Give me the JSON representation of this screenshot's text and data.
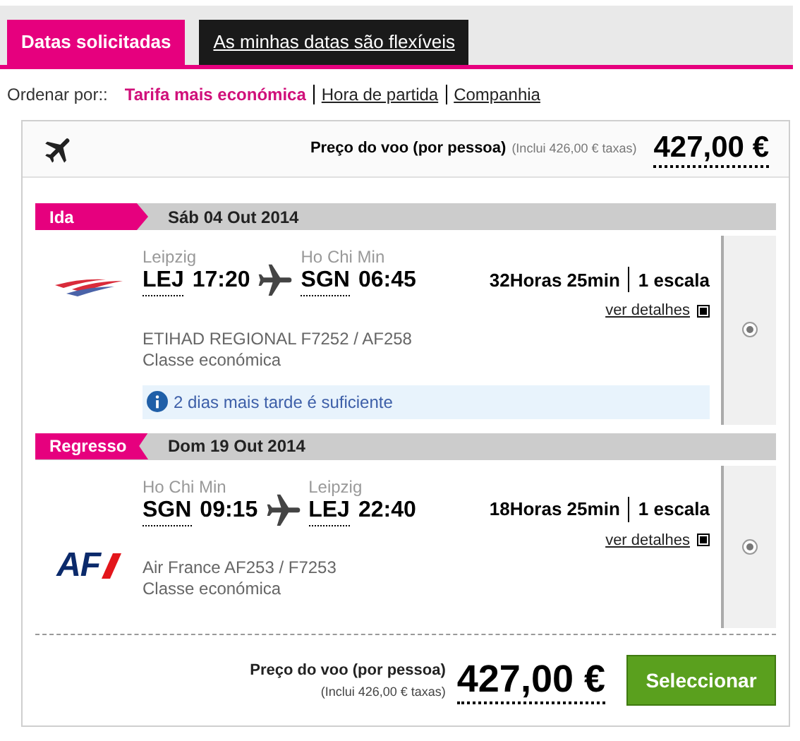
{
  "tabs": [
    {
      "label": "Datas solicitadas",
      "selected": true
    },
    {
      "label": "As minhas datas são flexíveis",
      "selected": false
    }
  ],
  "sort": {
    "label": "Ordenar por::",
    "options": [
      {
        "label": "Tarifa mais económica",
        "selected": true
      },
      {
        "label": "Hora de partida",
        "selected": false
      },
      {
        "label": "Companhia",
        "selected": false
      }
    ]
  },
  "header": {
    "price_label": "Preço do voo (por pessoa)",
    "taxes": "(Inclui 426,00 € taxas)",
    "price": "427,00 €"
  },
  "legs": [
    {
      "kind": "outbound",
      "tag": "Ida",
      "date": "Sáb 04 Out 2014",
      "logo": {
        "kind": "swoosh"
      },
      "from_city": "Leipzig",
      "from_code": "LEJ",
      "from_time": "17:20",
      "to_city": "Ho Chi Min",
      "to_code": "SGN",
      "to_time": "06:45",
      "duration": "32Horas 25min",
      "stops": "1 escala",
      "details": "ver detalhes",
      "flight": "ETIHAD REGIONAL F7252 / AF258",
      "cabin": "Classe económica",
      "note": "2 dias mais tarde é suficiente",
      "selected": true
    },
    {
      "kind": "return",
      "tag": "Regresso",
      "date": "Dom 19 Out 2014",
      "logo": {
        "kind": "wordmark",
        "text": "AF"
      },
      "from_city": "Ho Chi Min",
      "from_code": "SGN",
      "from_time": "09:15",
      "to_city": "Leipzig",
      "to_code": "LEJ",
      "to_time": "22:40",
      "duration": "18Horas 25min",
      "stops": "1 escala",
      "details": "ver detalhes",
      "flight": "Air France AF253 / F7253",
      "cabin": "Classe económica",
      "selected": true
    }
  ],
  "footer": {
    "price_label": "Preço do voo (por pessoa)",
    "taxes": "(Inclui 426,00 € taxas)",
    "price": "427,00 €",
    "button": "Seleccionar"
  }
}
